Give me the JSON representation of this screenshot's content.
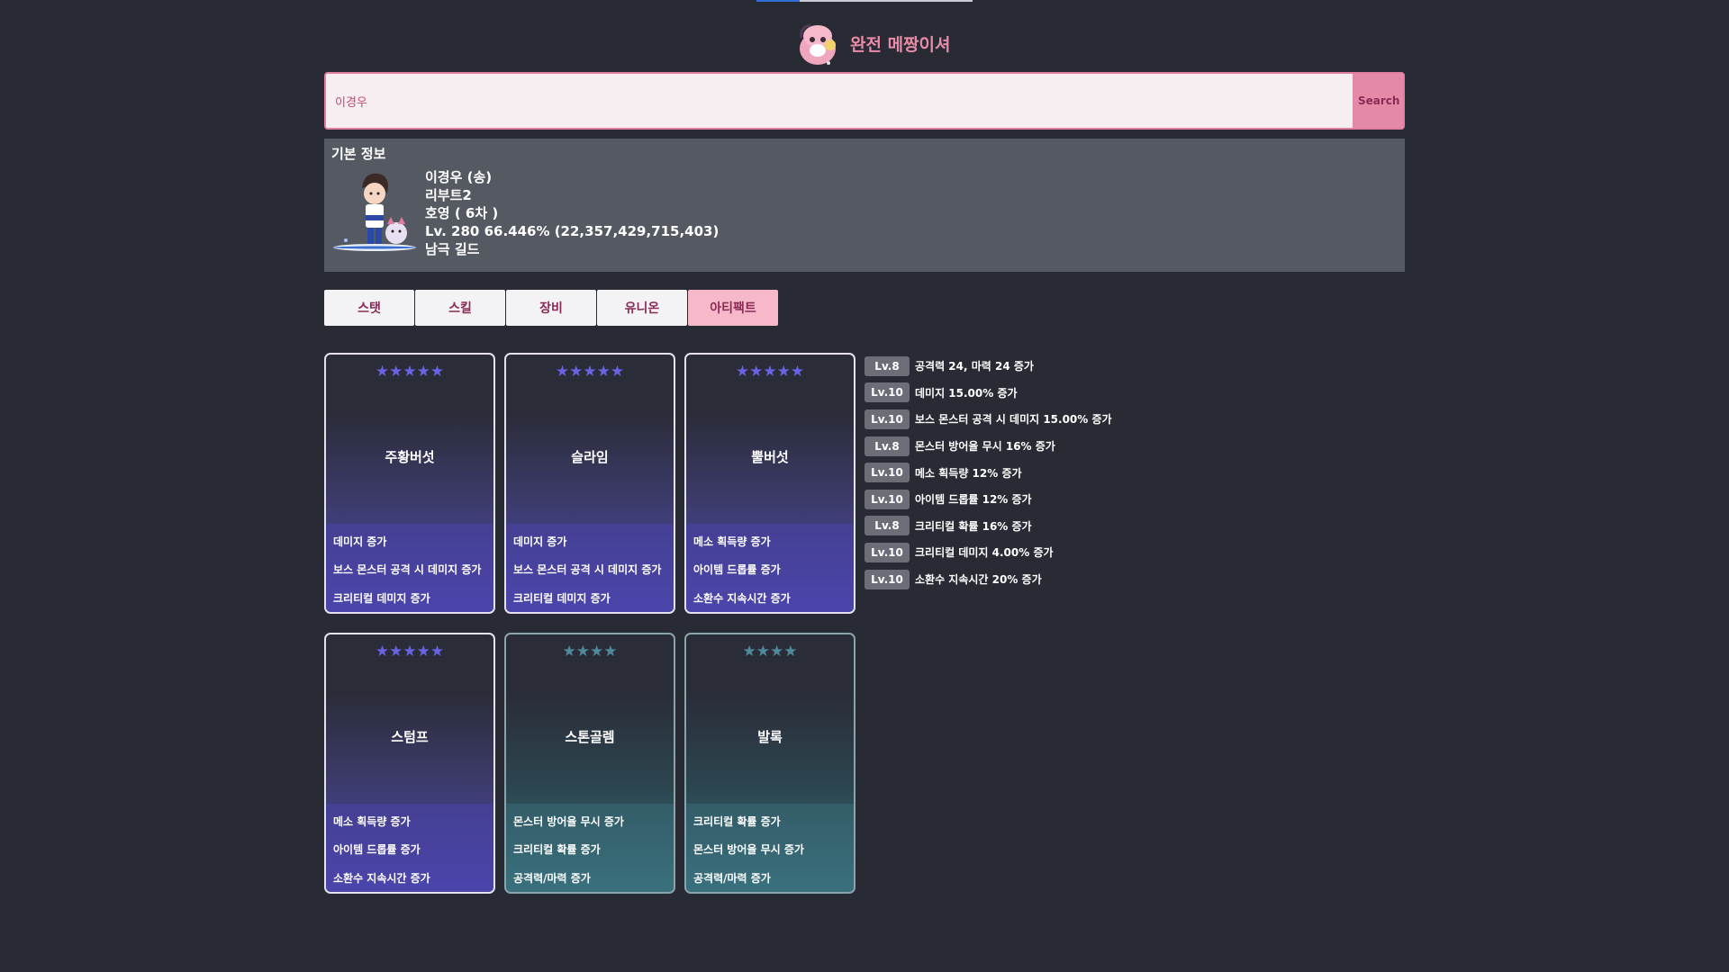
{
  "header": {
    "brand": "완전 메짱이셔",
    "brand_color": "#e98aa8",
    "mascot_icon": "pink-bean-mascot-icon"
  },
  "search": {
    "value": "이경우",
    "button_label": "Search"
  },
  "basic_info": {
    "title": "기본 정보",
    "name_line": "이경우 (송)",
    "world": "리부트2",
    "job": "호영 ( 6차 )",
    "level_line": "Lv. 280 66.446% (22,357,429,715,403)",
    "guild": "남극 길드"
  },
  "tabs": [
    {
      "label": "스탯"
    },
    {
      "label": "스킬"
    },
    {
      "label": "장비"
    },
    {
      "label": "유니온"
    },
    {
      "label": "아티팩트"
    }
  ],
  "active_tab": "아티팩트",
  "artifact_cards": [
    {
      "stars": "★★★★★",
      "name": "주황버섯",
      "effects": [
        "데미지 증가",
        "보스 몬스터 공격 시 데미지 증가",
        "크리티컬 데미지 증가"
      ]
    },
    {
      "stars": "★★★★★",
      "name": "슬라임",
      "effects": [
        "데미지 증가",
        "보스 몬스터 공격 시 데미지 증가",
        "크리티컬 데미지 증가"
      ]
    },
    {
      "stars": "★★★★★",
      "name": "뿔버섯",
      "effects": [
        "메소 획득량 증가",
        "아이템 드롭률 증가",
        "소환수 지속시간 증가"
      ]
    },
    {
      "stars": "★★★★★",
      "name": "스텀프",
      "effects": [
        "메소 획득량 증가",
        "아이템 드롭률 증가",
        "소환수 지속시간 증가"
      ]
    },
    {
      "stars": "★★★★",
      "name": "스톤골렘",
      "effects": [
        "몬스터 방어율 무시 증가",
        "크리티컬 확률 증가",
        "공격력/마력 증가"
      ]
    },
    {
      "stars": "★★★★",
      "name": "발록",
      "effects": [
        "크리티컬 확률 증가",
        "몬스터 방어율 무시 증가",
        "공격력/마력 증가"
      ]
    }
  ],
  "artifact_effects": [
    {
      "level": "Lv.8",
      "text": "공격력 24, 마력 24 증가"
    },
    {
      "level": "Lv.10",
      "text": "데미지 15.00% 증가"
    },
    {
      "level": "Lv.10",
      "text": "보스 몬스터 공격 시 데미지 15.00% 증가"
    },
    {
      "level": "Lv.8",
      "text": "몬스터 방어율 무시 16% 증가"
    },
    {
      "level": "Lv.10",
      "text": "메소 획득량 12% 증가"
    },
    {
      "level": "Lv.10",
      "text": "아이템 드롭률 12% 증가"
    },
    {
      "level": "Lv.8",
      "text": "크리티컬 확률 16% 증가"
    },
    {
      "level": "Lv.10",
      "text": "크리티컬 데미지 4.00% 증가"
    },
    {
      "level": "Lv.10",
      "text": "소환수 지속시간 20% 증가"
    }
  ]
}
